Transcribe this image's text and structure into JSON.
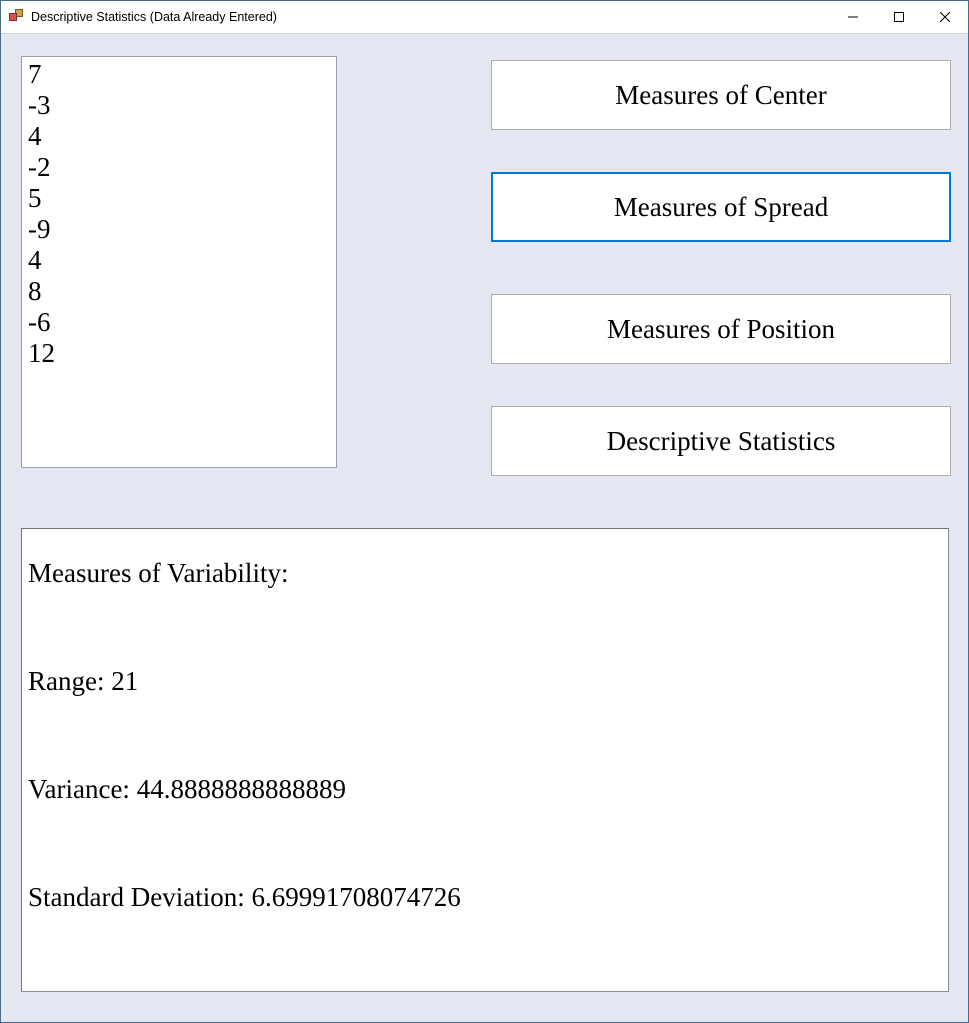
{
  "window": {
    "title": "Descriptive Statistics (Data Already Entered)"
  },
  "data_list": {
    "items": [
      "7",
      "-3",
      "4",
      "-2",
      "5",
      "-9",
      "4",
      "8",
      "-6",
      "12"
    ]
  },
  "buttons": {
    "center": "Measures of Center",
    "spread": "Measures of Spread",
    "position": "Measures of Position",
    "descriptive": "Descriptive Statistics"
  },
  "output": {
    "heading": "Measures of Variability:",
    "range_label": "Range: ",
    "range_value": "21",
    "variance_label": "Variance: ",
    "variance_value": "44.8888888888889",
    "stddev_label": "Standard Deviation: ",
    "stddev_value": "6.69991708074726"
  }
}
